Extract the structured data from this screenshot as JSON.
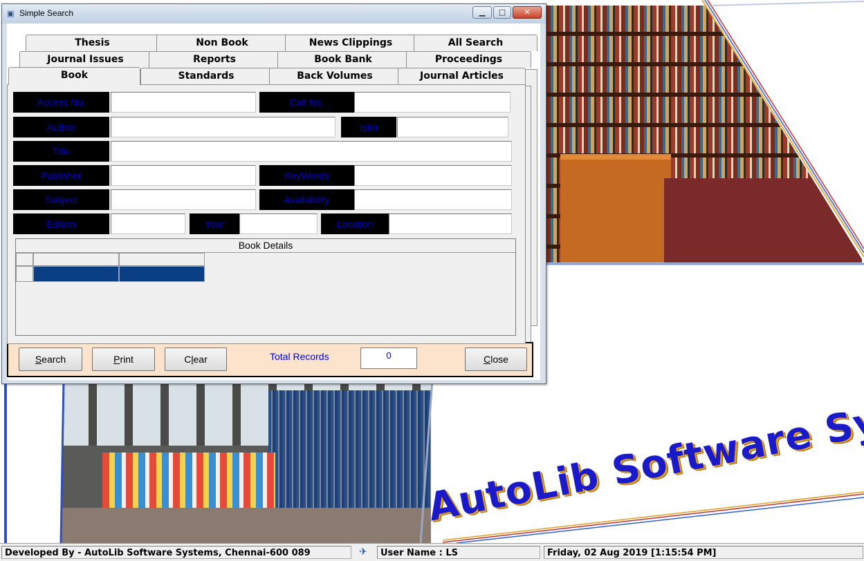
{
  "window": {
    "title": "Simple Search"
  },
  "tabs": {
    "row1": [
      "Thesis",
      "Non Book",
      "News Clippings",
      "All Search"
    ],
    "row2": [
      "Journal Issues",
      "Reports",
      "Book Bank",
      "Proceedings"
    ],
    "row3": [
      "Book",
      "Standards",
      "Back Volumes",
      "Journal Articles"
    ],
    "active": "Book"
  },
  "form": {
    "access_no": {
      "label": "Access No.",
      "value": ""
    },
    "call_no": {
      "label": "Call No.",
      "value": ""
    },
    "author": {
      "label": "Author",
      "value": ""
    },
    "isbn": {
      "label": "Isbn",
      "value": ""
    },
    "title": {
      "label": "Title",
      "value": ""
    },
    "publisher": {
      "label": "Publisher",
      "value": ""
    },
    "keywords": {
      "label": "KeyWords",
      "value": ""
    },
    "subject": {
      "label": "Subject",
      "value": ""
    },
    "availability": {
      "label": "Availability",
      "value": ""
    },
    "edition": {
      "label": "Edition",
      "value": ""
    },
    "year": {
      "label": "Year",
      "value": ""
    },
    "location": {
      "label": "Location",
      "value": ""
    }
  },
  "grid": {
    "caption": "Book Details"
  },
  "commands": {
    "search": {
      "u": "S",
      "rest": "earch"
    },
    "print": {
      "u": "P",
      "rest": "rint"
    },
    "clear_pre": "C",
    "clear_u": "l",
    "clear_rest": "ear",
    "close_pre": "",
    "close_u": "C",
    "close_rest": "lose",
    "total_label": "Total Records",
    "total_value": "0"
  },
  "brand": {
    "logo_text": "AutoLib Software Systems"
  },
  "statusbar": {
    "developer": "Developed By -  AutoLib Software Systems, Chennai-600 089",
    "user": "User Name : LS",
    "datetime": "Friday, 02 Aug 2019 [1:15:54 PM]"
  },
  "colors": {
    "label_bg": "#000000",
    "label_text": "#0000cc",
    "grid_selected": "#0b3f84",
    "command_panel": "#fbe3cc"
  }
}
